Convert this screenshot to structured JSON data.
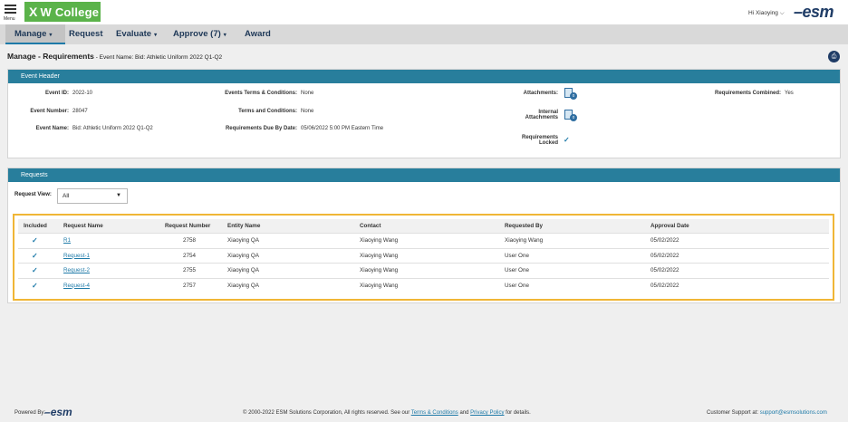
{
  "app": {
    "menu_label": "Menu",
    "logo_text": "W College",
    "logo_mark": "X",
    "user_greeting": "Hi Xiaoying",
    "brand": "esm"
  },
  "nav": {
    "items": [
      {
        "label": "Manage",
        "caret": "▾"
      },
      {
        "label": "Request",
        "caret": ""
      },
      {
        "label": "Evaluate",
        "caret": "▾"
      },
      {
        "label": "Approve (7)",
        "caret": "▾"
      },
      {
        "label": "Award",
        "caret": ""
      }
    ]
  },
  "breadcrumb": {
    "root": "Manage",
    "separator": " - ",
    "page": "Requirements",
    "detail": " - Event Name: Bid: Athletic Uniform 2022 Q1-Q2"
  },
  "event_header": {
    "title": "Event Header",
    "event_id_label": "Event ID:",
    "event_id": "2022-10",
    "event_number_label": "Event Number:",
    "event_number": "28047",
    "event_name_label": "Event Name:",
    "event_name": "Bid: Athletic Uniform 2022 Q1-Q2",
    "terms_events_label": "Events Terms & Conditions:",
    "terms_events": "None",
    "terms_label": "Terms and Conditions:",
    "terms": "None",
    "due_label": "Requirements Due By Date:",
    "due": "05/06/2022 5:00 PM Eastern Time",
    "attachments_label": "Attachments:",
    "attachments_count": "0",
    "internal_label_1": "Internal",
    "internal_label_2": "Attachments",
    "internal_count": "0",
    "req_locked_label_1": "Requirements",
    "req_locked_label_2": "Locked",
    "req_locked_value": "✓",
    "req_combined_label": "Requirements Combined:",
    "req_combined": "Yes"
  },
  "requests": {
    "title": "Requests",
    "view_label": "Request View:",
    "view_value": "All",
    "columns": [
      "Included",
      "Request Name",
      "Request Number",
      "Entity Name",
      "Contact",
      "Requested By",
      "Approval Date"
    ],
    "rows": [
      {
        "included": "✓",
        "name": "R1",
        "number": "2758",
        "entity": "Xiaoying QA",
        "contact": "Xiaoying Wang",
        "requested_by": "Xiaoying Wang",
        "approval_date": "05/02/2022"
      },
      {
        "included": "✓",
        "name": "Request-1",
        "number": "2754",
        "entity": "Xiaoying QA",
        "contact": "Xiaoying Wang",
        "requested_by": "User One",
        "approval_date": "05/02/2022"
      },
      {
        "included": "✓",
        "name": "Request-2",
        "number": "2755",
        "entity": "Xiaoying QA",
        "contact": "Xiaoying Wang",
        "requested_by": "User One",
        "approval_date": "05/02/2022"
      },
      {
        "included": "✓",
        "name": "Request-4",
        "number": "2757",
        "entity": "Xiaoying QA",
        "contact": "Xiaoying Wang",
        "requested_by": "User One",
        "approval_date": "05/02/2022"
      }
    ]
  },
  "footer": {
    "powered_by": "Powered By:",
    "brand": "esm",
    "copyright_pre": "© 2000-2022 ESM Solutions Corporation, All rights reserved. See our ",
    "terms_link": "Terms & Conditions",
    "and": " and ",
    "privacy_link": "Privacy Policy",
    "copyright_post": " for details.",
    "support_label": "Customer Support at: ",
    "support_email": "support@esmsolutions.com"
  },
  "colors": {
    "accent": "#287e9c",
    "logo_green": "#5bb34a",
    "highlight_border": "#f0b636",
    "link": "#1e7aa8"
  }
}
